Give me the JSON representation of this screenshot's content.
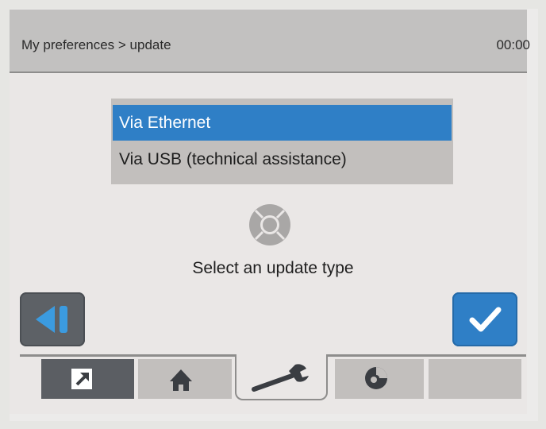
{
  "header": {
    "breadcrumb": "My preferences > update",
    "clock": "00:00"
  },
  "update_list": {
    "options": [
      {
        "label": "Via Ethernet",
        "selected": true
      },
      {
        "label": "Via USB (technical assistance)",
        "selected": false
      }
    ]
  },
  "prompt": "Select an update type",
  "colors": {
    "accent": "#2f7fc6",
    "header_bg": "#c2c1c0",
    "dark_button": "#5d6166"
  },
  "icons": {
    "back_button": "back-icon",
    "ok_button": "checkmark-icon",
    "nav_pad": "navigation-pad-icon",
    "tabs": [
      "exit-arrow-icon",
      "home-icon",
      "wrench-icon",
      "settings-disc-icon",
      ""
    ]
  }
}
